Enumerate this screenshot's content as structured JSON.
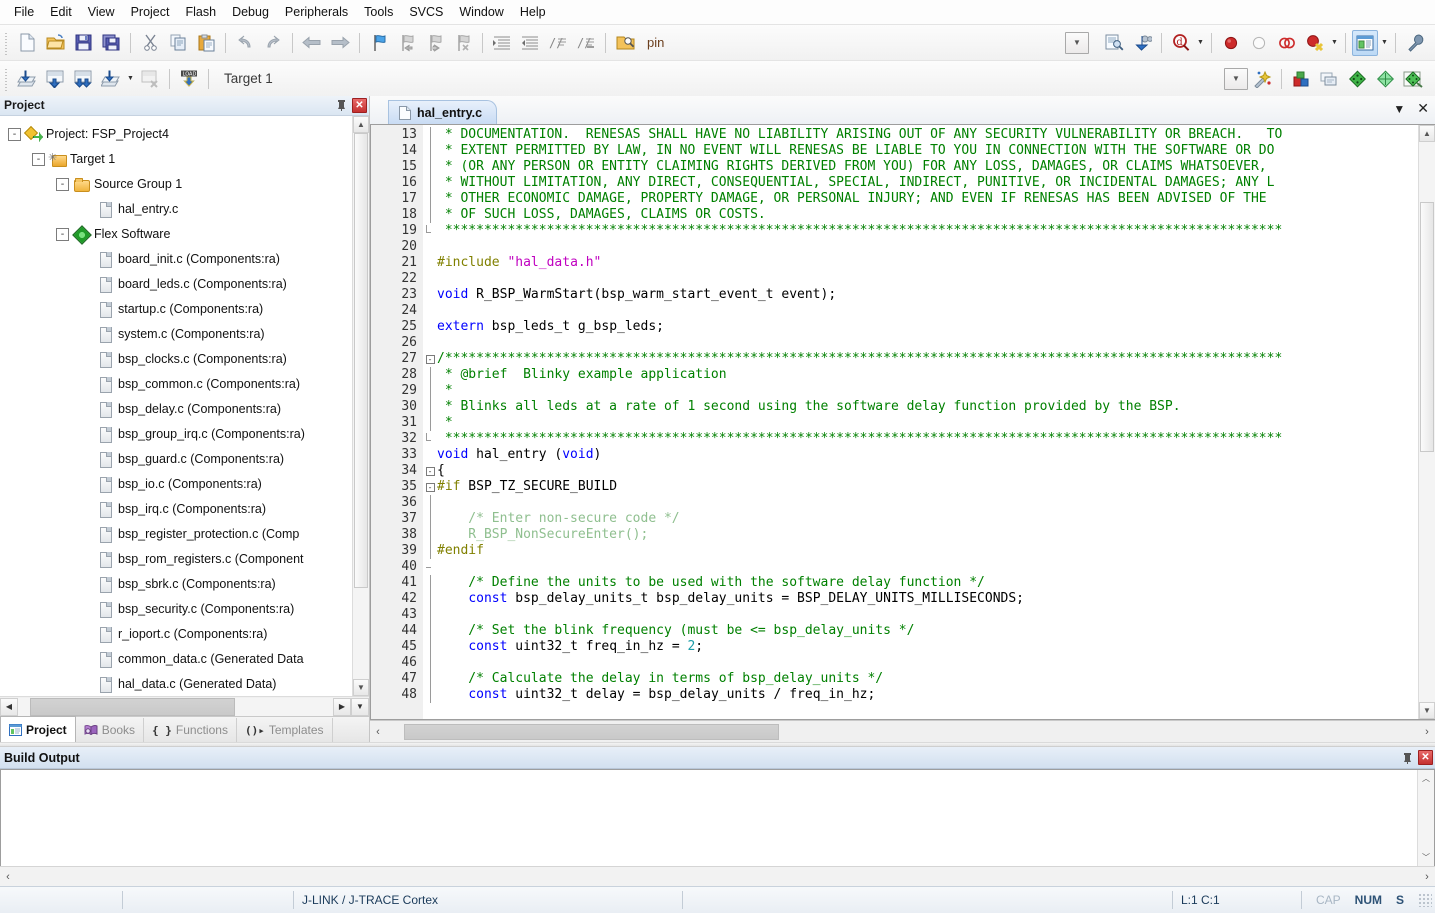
{
  "window": {
    "title": "hal_entry.c",
    "ide": "Keil uVision"
  },
  "menubar": {
    "items": [
      "File",
      "Edit",
      "View",
      "Project",
      "Flash",
      "Debug",
      "Peripherals",
      "Tools",
      "SVCS",
      "Window",
      "Help"
    ]
  },
  "toolbar_main": {
    "buttons": [
      {
        "name": "new-file",
        "icon": "new-file-icon"
      },
      {
        "name": "open-file",
        "icon": "open-folder-icon"
      },
      {
        "name": "save",
        "icon": "save-icon"
      },
      {
        "name": "save-all",
        "icon": "save-all-icon"
      },
      {
        "name": "cut",
        "icon": "scissors-icon"
      },
      {
        "name": "copy",
        "icon": "copy-icon"
      },
      {
        "name": "paste",
        "icon": "paste-icon"
      },
      {
        "name": "undo",
        "icon": "undo-icon"
      },
      {
        "name": "redo",
        "icon": "redo-icon"
      },
      {
        "name": "navigate-back",
        "icon": "arrow-left-icon"
      },
      {
        "name": "navigate-forward",
        "icon": "arrow-right-icon"
      },
      {
        "name": "bookmark-toggle",
        "icon": "flag-icon"
      },
      {
        "name": "bookmark-prev",
        "icon": "flag-prev-icon"
      },
      {
        "name": "bookmark-next",
        "icon": "flag-next-icon"
      },
      {
        "name": "bookmark-clear",
        "icon": "flag-clear-icon"
      },
      {
        "name": "indent",
        "icon": "indent-right-icon"
      },
      {
        "name": "outdent",
        "icon": "indent-left-icon"
      },
      {
        "name": "comment-lines",
        "icon": "comment-icon"
      },
      {
        "name": "uncomment-lines",
        "icon": "uncomment-icon"
      },
      {
        "name": "find-in-files",
        "icon": "find-folder-icon"
      }
    ],
    "find_box_value": "pin",
    "find_placeholder": "",
    "right_buttons": [
      {
        "name": "find-dropdown",
        "icon": "chevron-down-icon"
      },
      {
        "name": "browse-info",
        "icon": "document-search-icon"
      },
      {
        "name": "find-next",
        "icon": "binoculars-down-icon"
      },
      {
        "name": "debug-start",
        "icon": "debug-magnifier-icon"
      },
      {
        "name": "insert-breakpoint",
        "icon": "red-dot-icon"
      },
      {
        "name": "disable-breakpoint",
        "icon": "hollow-dot-icon"
      },
      {
        "name": "disable-all-breakpoints",
        "icon": "two-rings-icon"
      },
      {
        "name": "kill-all-breakpoints",
        "icon": "red-dot-x-icon"
      },
      {
        "name": "manage-windows",
        "icon": "window-layout-icon"
      },
      {
        "name": "configure-target",
        "icon": "wrench-icon"
      }
    ]
  },
  "toolbar_build": {
    "buttons": [
      {
        "name": "translate",
        "icon": "translate-icon"
      },
      {
        "name": "build",
        "icon": "build-icon"
      },
      {
        "name": "rebuild",
        "icon": "rebuild-icon"
      },
      {
        "name": "batch-build",
        "icon": "batch-build-icon"
      },
      {
        "name": "stop-build",
        "icon": "stop-build-icon"
      },
      {
        "name": "download",
        "icon": "load-download-icon"
      }
    ],
    "target_label": "Target 1",
    "right_buttons": [
      {
        "name": "target-dropdown",
        "icon": "chevron-down-icon"
      },
      {
        "name": "target-options-wizard",
        "icon": "magic-wand-icon"
      },
      {
        "name": "manage-project-items",
        "icon": "project-items-icon"
      },
      {
        "name": "manage-multi-project",
        "icon": "multi-project-icon"
      },
      {
        "name": "manage-run-time-env",
        "icon": "green-diamond-icon"
      },
      {
        "name": "pack-installer",
        "icon": "pack-installer-icon"
      },
      {
        "name": "flex-configuration",
        "icon": "flex-config-icon"
      }
    ]
  },
  "project_pane": {
    "caption": "Project",
    "pin_icon": "pin-icon",
    "close_icon": "close-icon",
    "tree": [
      {
        "label": "Project: FSP_Project4",
        "icon": "project-icon",
        "depth": 0,
        "expander": "-"
      },
      {
        "label": "Target 1",
        "icon": "target-icon",
        "depth": 1,
        "expander": "-"
      },
      {
        "label": "Source Group 1",
        "icon": "folder-icon",
        "depth": 2,
        "expander": "-"
      },
      {
        "label": "hal_entry.c",
        "icon": "file-icon",
        "depth": 3,
        "expander": ""
      },
      {
        "label": "Flex Software",
        "icon": "flex-icon",
        "depth": 2,
        "expander": "-"
      },
      {
        "label": "board_init.c (Components:ra)",
        "icon": "file-icon",
        "depth": 3,
        "expander": ""
      },
      {
        "label": "board_leds.c (Components:ra)",
        "icon": "file-icon",
        "depth": 3,
        "expander": ""
      },
      {
        "label": "startup.c (Components:ra)",
        "icon": "file-icon",
        "depth": 3,
        "expander": ""
      },
      {
        "label": "system.c (Components:ra)",
        "icon": "file-icon",
        "depth": 3,
        "expander": ""
      },
      {
        "label": "bsp_clocks.c (Components:ra)",
        "icon": "file-icon",
        "depth": 3,
        "expander": ""
      },
      {
        "label": "bsp_common.c (Components:ra)",
        "icon": "file-icon",
        "depth": 3,
        "expander": ""
      },
      {
        "label": "bsp_delay.c (Components:ra)",
        "icon": "file-icon",
        "depth": 3,
        "expander": ""
      },
      {
        "label": "bsp_group_irq.c (Components:ra)",
        "icon": "file-icon",
        "depth": 3,
        "expander": ""
      },
      {
        "label": "bsp_guard.c (Components:ra)",
        "icon": "file-icon",
        "depth": 3,
        "expander": ""
      },
      {
        "label": "bsp_io.c (Components:ra)",
        "icon": "file-icon",
        "depth": 3,
        "expander": ""
      },
      {
        "label": "bsp_irq.c (Components:ra)",
        "icon": "file-icon",
        "depth": 3,
        "expander": ""
      },
      {
        "label": "bsp_register_protection.c (Comp",
        "icon": "file-icon",
        "depth": 3,
        "expander": ""
      },
      {
        "label": "bsp_rom_registers.c (Component",
        "icon": "file-icon",
        "depth": 3,
        "expander": ""
      },
      {
        "label": "bsp_sbrk.c (Components:ra)",
        "icon": "file-icon",
        "depth": 3,
        "expander": ""
      },
      {
        "label": "bsp_security.c (Components:ra)",
        "icon": "file-icon",
        "depth": 3,
        "expander": ""
      },
      {
        "label": "r_ioport.c (Components:ra)",
        "icon": "file-icon",
        "depth": 3,
        "expander": ""
      },
      {
        "label": "common_data.c (Generated Data",
        "icon": "file-icon",
        "depth": 3,
        "expander": ""
      },
      {
        "label": "hal_data.c (Generated Data)",
        "icon": "file-icon",
        "depth": 3,
        "expander": ""
      }
    ],
    "tabs": [
      {
        "label": "Project",
        "icon": "project-window-icon",
        "selected": true
      },
      {
        "label": "Books",
        "icon": "books-icon",
        "selected": false
      },
      {
        "label": "Functions",
        "icon": "braces-icon",
        "selected": false
      },
      {
        "label": "Templates",
        "icon": "templates-icon",
        "selected": false
      }
    ]
  },
  "editor": {
    "tab_label": "hal_entry.c",
    "tab_icon": "c-file-icon",
    "tab_menu_icon": "chevron-down-icon",
    "tab_close_icon": "close-icon",
    "first_line": 13,
    "lines": [
      {
        "n": 13,
        "fold": "bar",
        "segs": [
          {
            "t": " * DOCUMENTATION.  RENESAS SHALL HAVE NO LIABILITY ARISING OUT OF ANY SECURITY VULNERABILITY OR BREACH.   TO",
            "c": "cm"
          }
        ]
      },
      {
        "n": 14,
        "fold": "bar",
        "segs": [
          {
            "t": " * EXTENT PERMITTED BY LAW, IN NO EVENT WILL RENESAS BE LIABLE TO YOU IN CONNECTION WITH THE SOFTWARE OR DO",
            "c": "cm"
          }
        ]
      },
      {
        "n": 15,
        "fold": "bar",
        "segs": [
          {
            "t": " * (OR ANY PERSON OR ENTITY CLAIMING RIGHTS DERIVED FROM YOU) FOR ANY LOSS, DAMAGES, OR CLAIMS WHATSOEVER,",
            "c": "cm"
          }
        ]
      },
      {
        "n": 16,
        "fold": "bar",
        "segs": [
          {
            "t": " * WITHOUT LIMITATION, ANY DIRECT, CONSEQUENTIAL, SPECIAL, INDIRECT, PUNITIVE, OR INCIDENTAL DAMAGES; ANY L",
            "c": "cm"
          }
        ]
      },
      {
        "n": 17,
        "fold": "bar",
        "segs": [
          {
            "t": " * OTHER ECONOMIC DAMAGE, PROPERTY DAMAGE, OR PERSONAL INJURY; AND EVEN IF RENESAS HAS BEEN ADVISED OF THE",
            "c": "cm"
          }
        ]
      },
      {
        "n": 18,
        "fold": "bar",
        "segs": [
          {
            "t": " * OF SUCH LOSS, DAMAGES, CLAIMS OR COSTS.",
            "c": "cm"
          }
        ]
      },
      {
        "n": 19,
        "fold": "end",
        "segs": [
          {
            "t": " ***********************************************************************************************************",
            "c": "cm"
          }
        ]
      },
      {
        "n": 20,
        "fold": "none",
        "segs": [
          {
            "t": "",
            "c": "pl"
          }
        ]
      },
      {
        "n": 21,
        "fold": "none",
        "segs": [
          {
            "t": "#include ",
            "c": "pp"
          },
          {
            "t": "\"hal_data.h\"",
            "c": "str"
          }
        ]
      },
      {
        "n": 22,
        "fold": "none",
        "segs": [
          {
            "t": "",
            "c": "pl"
          }
        ]
      },
      {
        "n": 23,
        "fold": "none",
        "segs": [
          {
            "t": "void",
            "c": "kw"
          },
          {
            "t": " R_BSP_WarmStart(bsp_warm_start_event_t event);",
            "c": "pl"
          }
        ]
      },
      {
        "n": 24,
        "fold": "none",
        "segs": [
          {
            "t": "",
            "c": "pl"
          }
        ]
      },
      {
        "n": 25,
        "fold": "none",
        "segs": [
          {
            "t": "extern",
            "c": "kw"
          },
          {
            "t": " bsp_leds_t g_bsp_leds;",
            "c": "pl"
          }
        ]
      },
      {
        "n": 26,
        "fold": "none",
        "segs": [
          {
            "t": "",
            "c": "pl"
          }
        ]
      },
      {
        "n": 27,
        "fold": "box",
        "segs": [
          {
            "t": "/***********************************************************************************************************",
            "c": "cm"
          }
        ]
      },
      {
        "n": 28,
        "fold": "bar",
        "segs": [
          {
            "t": " * @brief  Blinky example application",
            "c": "cm"
          }
        ]
      },
      {
        "n": 29,
        "fold": "bar",
        "segs": [
          {
            "t": " *",
            "c": "cm"
          }
        ]
      },
      {
        "n": 30,
        "fold": "bar",
        "segs": [
          {
            "t": " * Blinks all leds at a rate of 1 second using the software delay function provided by the BSP.",
            "c": "cm"
          }
        ]
      },
      {
        "n": 31,
        "fold": "bar",
        "segs": [
          {
            "t": " *",
            "c": "cm"
          }
        ]
      },
      {
        "n": 32,
        "fold": "end",
        "segs": [
          {
            "t": " ***********************************************************************************************************",
            "c": "cm"
          }
        ]
      },
      {
        "n": 33,
        "fold": "none",
        "segs": [
          {
            "t": "void",
            "c": "kw"
          },
          {
            "t": " hal_entry (",
            "c": "pl"
          },
          {
            "t": "void",
            "c": "kw"
          },
          {
            "t": ")",
            "c": "pl"
          }
        ]
      },
      {
        "n": 34,
        "fold": "box",
        "segs": [
          {
            "t": "{",
            "c": "pl"
          }
        ]
      },
      {
        "n": 35,
        "fold": "box2",
        "segs": [
          {
            "t": "#if",
            "c": "pp"
          },
          {
            "t": " BSP_TZ_SECURE_BUILD",
            "c": "pl"
          }
        ]
      },
      {
        "n": 36,
        "fold": "bar",
        "segs": [
          {
            "t": "",
            "c": "pl"
          }
        ]
      },
      {
        "n": 37,
        "fold": "bar",
        "segs": [
          {
            "t": "    /* Enter non-secure code */",
            "c": "cm-dim"
          }
        ]
      },
      {
        "n": 38,
        "fold": "bar",
        "segs": [
          {
            "t": "    R_BSP_NonSecureEnter();",
            "c": "cm-dim"
          }
        ]
      },
      {
        "n": 39,
        "fold": "bar",
        "segs": [
          {
            "t": "#endif",
            "c": "pp"
          }
        ]
      },
      {
        "n": 40,
        "fold": "tick",
        "segs": [
          {
            "t": "",
            "c": "pl"
          }
        ]
      },
      {
        "n": 41,
        "fold": "bar",
        "segs": [
          {
            "t": "    /* Define the units to be used with the software delay function */",
            "c": "cm"
          }
        ]
      },
      {
        "n": 42,
        "fold": "bar",
        "segs": [
          {
            "t": "    ",
            "c": "pl"
          },
          {
            "t": "const",
            "c": "kw"
          },
          {
            "t": " bsp_delay_units_t bsp_delay_units = BSP_DELAY_UNITS_MILLISECONDS;",
            "c": "pl"
          }
        ]
      },
      {
        "n": 43,
        "fold": "bar",
        "segs": [
          {
            "t": "",
            "c": "pl"
          }
        ]
      },
      {
        "n": 44,
        "fold": "bar",
        "segs": [
          {
            "t": "    /* Set the blink frequency (must be <= bsp_delay_units */",
            "c": "cm"
          }
        ]
      },
      {
        "n": 45,
        "fold": "bar",
        "segs": [
          {
            "t": "    ",
            "c": "pl"
          },
          {
            "t": "const",
            "c": "kw"
          },
          {
            "t": " uint32_t freq_in_hz = ",
            "c": "pl"
          },
          {
            "t": "2",
            "c": "num"
          },
          {
            "t": ";",
            "c": "pl"
          }
        ]
      },
      {
        "n": 46,
        "fold": "bar",
        "segs": [
          {
            "t": "",
            "c": "pl"
          }
        ]
      },
      {
        "n": 47,
        "fold": "bar",
        "segs": [
          {
            "t": "    /* Calculate the delay in terms of bsp_delay_units */",
            "c": "cm"
          }
        ]
      },
      {
        "n": 48,
        "fold": "bar",
        "segs": [
          {
            "t": "    ",
            "c": "pl"
          },
          {
            "t": "const",
            "c": "kw"
          },
          {
            "t": " uint32_t delay = bsp_delay_units / freq_in_hz;",
            "c": "pl"
          }
        ]
      }
    ]
  },
  "build_output": {
    "caption": "Build Output",
    "pin_icon": "pin-icon",
    "close_icon": "close-icon",
    "text": ""
  },
  "statusbar": {
    "left": "",
    "debugger": "J-LINK / J-TRACE Cortex",
    "middle": "",
    "cursor": "L:1 C:1",
    "keys": [
      {
        "label": "CAP",
        "on": false
      },
      {
        "label": "NUM",
        "on": true
      },
      {
        "label": "S",
        "on": true
      }
    ],
    "resize_grip_icon": "resize-grip-icon"
  },
  "colors": {
    "comment": "#008000",
    "comment_inactive": "#8fbf8f",
    "keyword": "#0000ff",
    "preprocessor": "#808000",
    "string": "#c000c0",
    "number": "#1a9ca8",
    "caption_bg": "#dbe6f2",
    "tab_selected": "#c9dcf4",
    "status_text": "#1a3a5a"
  }
}
